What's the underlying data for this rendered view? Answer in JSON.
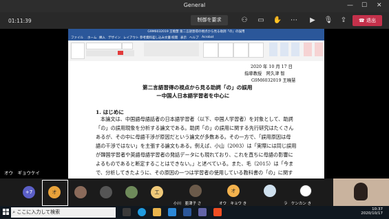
{
  "window": {
    "title": "General"
  },
  "toolbar": {
    "timer": "01:11:39",
    "request_control": "制御を要求",
    "leave": "退出",
    "icons": [
      "people-icon",
      "chat-icon",
      "raise-hand-icon",
      "more-icon",
      "camera-icon",
      "mic-icon",
      "share-icon"
    ]
  },
  "word": {
    "window_title": "G9M6032019 王曉慧 第二言語習得の視点から見る助詞「の」の誤用",
    "tabs": [
      "ファイル",
      "ホーム",
      "挿入",
      "デザイン",
      "レイアウト",
      "参考資料",
      "差し込み文書",
      "校閲",
      "表示",
      "ヘルプ",
      "Acrobat"
    ],
    "date_line": "2020 年 10 月 17 日",
    "advisor_line": "指導教授　阿久津 智",
    "author_line": "G9M6032019 王曉慧",
    "title": "第二言語習得の視点から見る助詞「の」の誤用",
    "subtitle": "ー中国人日本語学習者を中心に",
    "section_heading": "1. はじめに",
    "body_lines": [
      "本論文は、中国語母語話者の日本語学習者（以下、中国人学習者）を対象として、助詞",
      "「の」の誤用現象を分析する論文である。助詞「の」の誤用に関する先行研究はたくさん",
      "あるが、その中に母語干渉が原因だという論文が多数ある。その一方で、「誤用原因は母",
      "語の干渉ではない」を主張する論文もある。例えば、小山（2003）は「実際には同じ誤用",
      "が韓国学習者や英語母語学習者の発話データにも現れており、これを直ちに母語の影響に",
      "よるものであると断定することはできない。」と述べている。また、毛（2015）は「今ま",
      "で、分析してきたように、その原因の一つは学習者の使用している教科書の「の」に関す"
    ]
  },
  "presenter_label": "オウ　ギョウケイ",
  "participants": {
    "overflow": "+7",
    "tiles": [
      {
        "initial": "オ",
        "name": "",
        "color": "#e8a23a"
      },
      {
        "initial": "",
        "name": "",
        "color": "#8a6a5a"
      },
      {
        "initial": "",
        "name": "",
        "color": "#555555"
      },
      {
        "initial": "",
        "name": "",
        "color": "#6e8a5a"
      },
      {
        "initial": "工",
        "name": "",
        "color": "#f0c979"
      },
      {
        "initial": "",
        "name": "小川　亜津子 さ",
        "color": "#6b5a4a"
      },
      {
        "initial": "オ",
        "name": "オウ　キョウ き",
        "color": "#f4b24d"
      },
      {
        "initial": "",
        "name": "",
        "color": "#cfe0ee"
      },
      {
        "initial": "",
        "name": "ラ　ケンカン き",
        "color": "#ffffff"
      }
    ]
  },
  "taskbar": {
    "search_placeholder": "ここに入力して検索",
    "time": "10:37",
    "date": "2020/10/17"
  }
}
